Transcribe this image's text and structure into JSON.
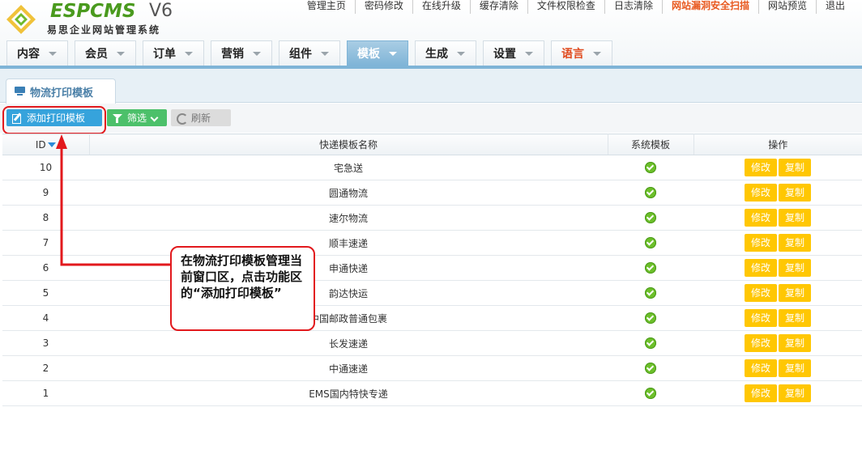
{
  "brand": {
    "logo_word": "ESPCMS",
    "logo_version": "V6",
    "logo_subtitle": "易思企业网站管理系统",
    "accent": "#4a9a1e"
  },
  "top_links": [
    "管理主页",
    "密码修改",
    "在线升级",
    "缓存清除",
    "文件权限检查",
    "日志清除",
    "网站漏洞安全扫描",
    "网站预览",
    "退出"
  ],
  "nav": {
    "tabs": [
      {
        "label": "内容"
      },
      {
        "label": "会员"
      },
      {
        "label": "订单"
      },
      {
        "label": "营销"
      },
      {
        "label": "组件"
      },
      {
        "label": "模板",
        "active": true
      },
      {
        "label": "生成"
      },
      {
        "label": "设置"
      },
      {
        "label": "语言",
        "highlight": true
      }
    ],
    "active_color": "#7fb4d7"
  },
  "subtab": {
    "label": "物流打印模板"
  },
  "toolbar": {
    "add_label": "添加打印模板",
    "filter_label": "筛选",
    "refresh_label": "刷新"
  },
  "table": {
    "headers": {
      "id": "ID",
      "name": "快递模板名称",
      "system": "系统模板",
      "actions": "操作"
    },
    "edit_label": "修改",
    "copy_label": "复制",
    "rows": [
      {
        "id": "10",
        "name": "宅急送"
      },
      {
        "id": "9",
        "name": "圆通物流"
      },
      {
        "id": "8",
        "name": "速尔物流"
      },
      {
        "id": "7",
        "name": "顺丰速递"
      },
      {
        "id": "6",
        "name": "申通快递"
      },
      {
        "id": "5",
        "name": "韵达快运"
      },
      {
        "id": "4",
        "name": "中国邮政普通包裹"
      },
      {
        "id": "3",
        "name": "长发速递"
      },
      {
        "id": "2",
        "name": "中通速递"
      },
      {
        "id": "1",
        "name": "EMS国内特快专递"
      }
    ]
  },
  "annotation": {
    "text": "在物流打印模板管理当前窗口区，点击功能区的“添加打印模板”",
    "color": "#e2191d"
  }
}
